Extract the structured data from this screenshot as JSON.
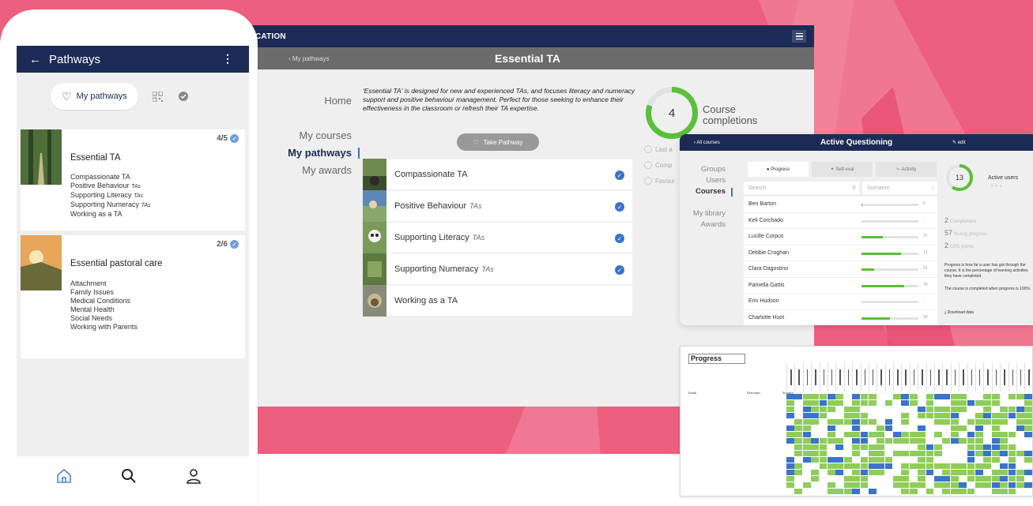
{
  "colors": {
    "pink": "#ec5f7f",
    "navy": "#1c2b55",
    "blue": "#3a74c9",
    "green": "#5bbf3a"
  },
  "phone": {
    "title": "Pathways",
    "tabs": {
      "my_pathways": "My pathways"
    },
    "cards": [
      {
        "title": "Essential TA",
        "count": "4/5",
        "items": [
          {
            "t": "Compassionate TA",
            "s": ""
          },
          {
            "t": "Positive Behaviour",
            "s": "TAs"
          },
          {
            "t": "Supporting Literacy",
            "s": "TAs"
          },
          {
            "t": "Supporting Numeracy",
            "s": "TAs"
          },
          {
            "t": "Working as a TA",
            "s": ""
          }
        ]
      },
      {
        "title": "Essential pastoral care",
        "count": "2/6",
        "items": [
          {
            "t": "Attachment",
            "s": ""
          },
          {
            "t": "Family Issues",
            "s": ""
          },
          {
            "t": "Medical Conditions",
            "s": ""
          },
          {
            "t": "Mental Health",
            "s": ""
          },
          {
            "t": "Social Needs",
            "s": ""
          },
          {
            "t": "Working with Parents",
            "s": ""
          }
        ]
      }
    ],
    "footer_icons": [
      "home-icon",
      "search-icon",
      "user-icon"
    ]
  },
  "desktop": {
    "brand": "CATION",
    "back": "My pathways",
    "title": "Essential TA",
    "nav": [
      "Home",
      "My courses",
      "My pathways",
      "My awards"
    ],
    "description": "'Essential TA' is designed for new and experienced TAs, and focuses literacy and numeracy support and positive behaviour management. Perfect for those seeking to enhance their effectiveness in the classroom or refresh their TA expertise.",
    "take_pathway": "Take Pathway",
    "courses": [
      {
        "label": "Compassionate TA",
        "tag": "",
        "done": true
      },
      {
        "label": "Positive Behaviour",
        "tag": "TAs",
        "done": true
      },
      {
        "label": "Supporting Literacy",
        "tag": "TAs",
        "done": true
      },
      {
        "label": "Supporting Numeracy",
        "tag": "TAs",
        "done": true
      },
      {
        "label": "Working as a TA",
        "tag": "",
        "done": false
      }
    ],
    "completions": {
      "value": "4",
      "label_1": "Course",
      "label_2": "completions",
      "fraction": 0.8
    },
    "stats": [
      "Last a",
      "Comp",
      "Favour"
    ]
  },
  "tablet": {
    "back": "All courses",
    "title": "Active Questioning",
    "edit": "edit",
    "nav": [
      "Groups",
      "Users",
      "Courses",
      "My library",
      "Awards"
    ],
    "tabs": [
      "Progress",
      "Self-eval",
      "Activity"
    ],
    "search_placeholder": "Search",
    "surname_placeholder": "Surname",
    "users": [
      {
        "name": "Ben Barton",
        "progress": 0.02,
        "val": "4"
      },
      {
        "name": "Keli Corchado",
        "progress": 0.0,
        "val": "-"
      },
      {
        "name": "Lucille Corpus",
        "progress": 0.38,
        "val": "37"
      },
      {
        "name": "Debbie Croghan",
        "progress": 0.7,
        "val": "71"
      },
      {
        "name": "Clara Dagostino",
        "progress": 0.22,
        "val": "21"
      },
      {
        "name": "Pamella Gattis",
        "progress": 0.75,
        "val": "75"
      },
      {
        "name": "Erin Hudson",
        "progress": 0.0,
        "val": "-"
      },
      {
        "name": "Charlotte Huot",
        "progress": 0.5,
        "val": "50"
      }
    ],
    "active_users": {
      "value": "13",
      "label": "Active users",
      "fraction": 0.6
    },
    "completions": {
      "value": "2",
      "label": "Completions"
    },
    "avg_progress": {
      "value": "57",
      "label": "% Avg progress"
    },
    "cpd": {
      "value": "2",
      "label": "CPD points"
    },
    "para_1": "Progress is how far a user has got through the course. It is the percentage of learning activities they have completed.",
    "para_2": "The course is completed when progress is 100%.",
    "download": "Download data"
  },
  "sheet": {
    "title": "Progress",
    "headers": [
      "Email",
      "First nam",
      "Surnam"
    ]
  }
}
